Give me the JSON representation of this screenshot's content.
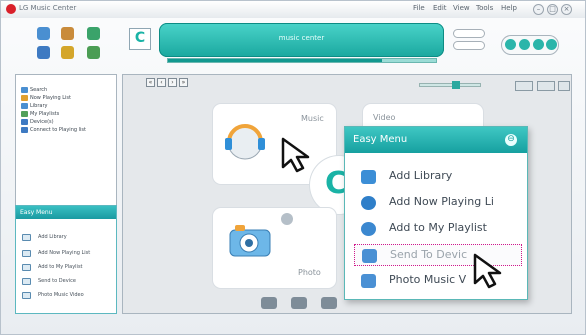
{
  "window": {
    "title": "LG Music Center",
    "menus": [
      "File",
      "Edit",
      "View",
      "Tools",
      "Help"
    ]
  },
  "display": {
    "logo_text": "music center"
  },
  "tree": {
    "items": [
      "Search",
      "Now Playing List",
      "Library",
      "My Playlists",
      "Device(s)",
      "Connect to Playing list"
    ]
  },
  "easy_menu_small": {
    "title": "Easy Menu",
    "items": [
      "Add Library",
      "Add Now Playing List",
      "Add to My Playlist",
      "Send to Device",
      "Photo Music Video"
    ]
  },
  "categories": {
    "music": "Music",
    "video": "Video",
    "photo": "Photo"
  },
  "easy_menu_popup": {
    "title": "Easy Menu",
    "items": [
      "Add Library",
      "Add Now Playing Li",
      "Add to My Playlist",
      "Send To Devic",
      "Photo Music V"
    ]
  },
  "colors": {
    "accent": "#1ab3a6",
    "popup_header": "#2fb6b4",
    "selection_border": "#d0188c"
  },
  "icons": [
    "app-logo-icon",
    "collapse-icon",
    "arrow-cursor-icon"
  ]
}
